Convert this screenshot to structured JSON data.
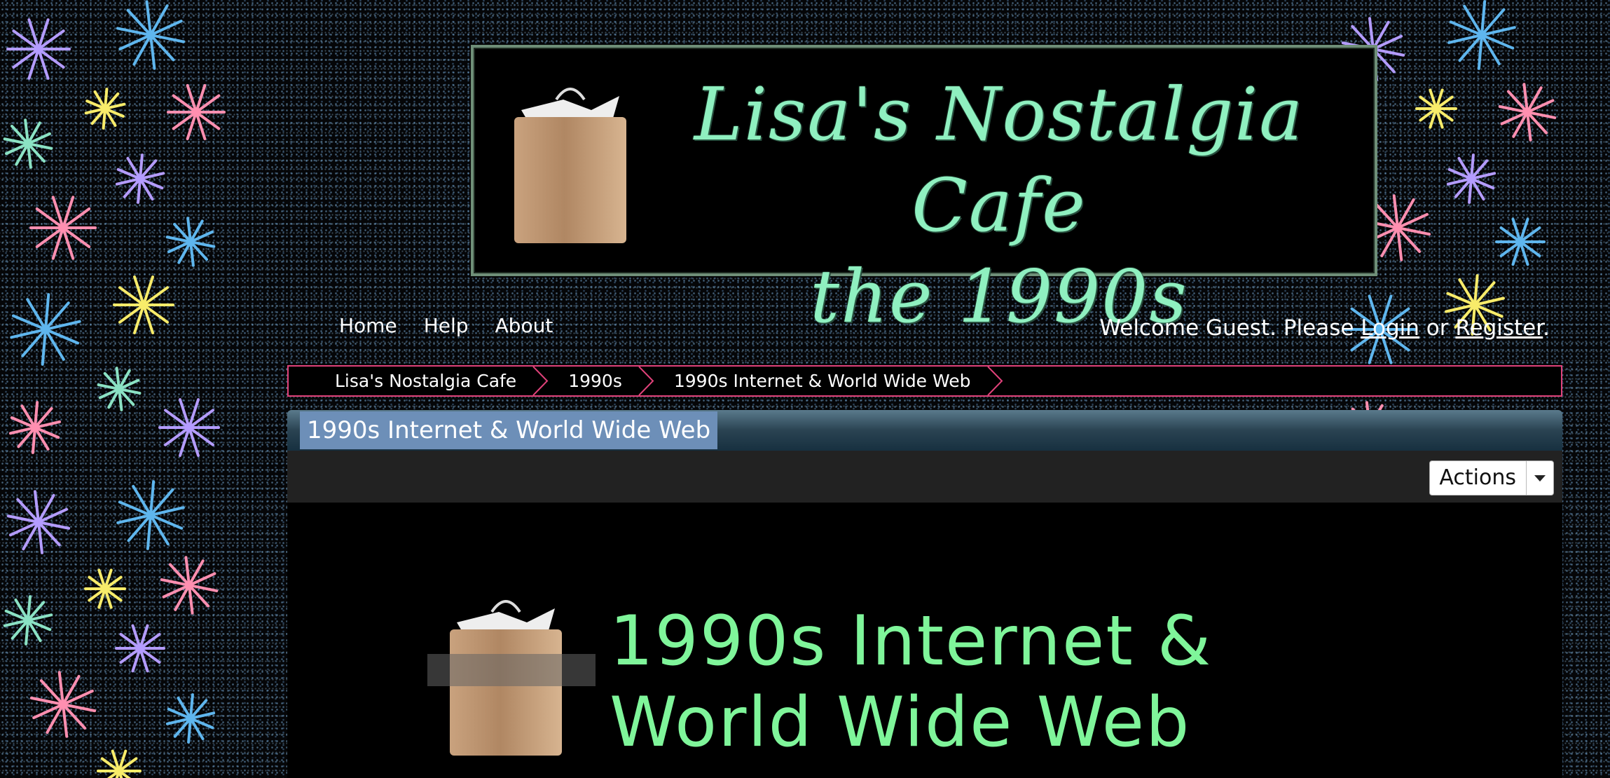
{
  "banner": {
    "title_line1": "Lisa's Nostalgia Cafe",
    "title_line2": "the 1990s"
  },
  "nav": {
    "home": "Home",
    "help": "Help",
    "about": "About"
  },
  "welcome": {
    "prefix": "Welcome Guest. Please ",
    "login": "Login",
    "or": " or ",
    "register": "Register",
    "suffix": "."
  },
  "breadcrumb": [
    "Lisa's Nostalgia Cafe",
    "1990s",
    "1990s Internet & World Wide Web"
  ],
  "category": {
    "title": "1990s Internet & World Wide Web",
    "actions_label": "Actions"
  },
  "content": {
    "title_line1": "1990s Internet &",
    "title_line2": "World Wide Web"
  },
  "colors": {
    "breadcrumb_border": "#e0427a",
    "banner_text": "#8ff0c0",
    "content_title": "#7ff59a"
  },
  "icons": {
    "bag": "shopping-bag-icon",
    "caret": "caret-down-icon",
    "star": "star-sparkle-icon"
  }
}
